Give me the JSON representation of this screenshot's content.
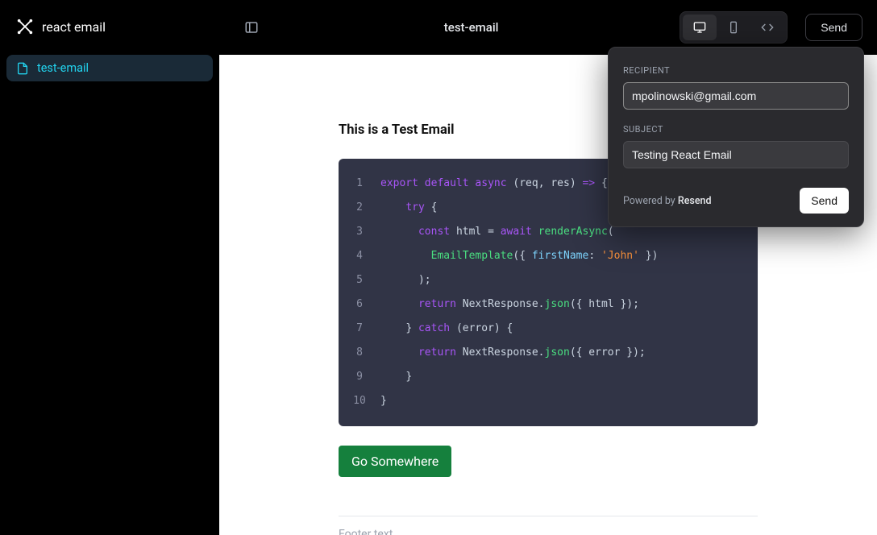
{
  "brand": {
    "name": "react email"
  },
  "sidebar": {
    "items": [
      {
        "label": "test-email"
      }
    ]
  },
  "header": {
    "title": "test-email",
    "send_label": "Send"
  },
  "preview": {
    "heading": "This is a Test Email",
    "cta_label": "Go Somewhere",
    "footer": "Footer text...",
    "code": {
      "lines": [
        {
          "n": "1",
          "indent": "",
          "tokens": [
            {
              "t": "export ",
              "c": "kw"
            },
            {
              "t": "default ",
              "c": "kw"
            },
            {
              "t": "async ",
              "c": "kw"
            },
            {
              "t": "(req, res) ",
              "c": "id"
            },
            {
              "t": "=>",
              "c": "kw"
            },
            {
              "t": " {",
              "c": "punc"
            }
          ]
        },
        {
          "n": "2",
          "indent": "    ",
          "tokens": [
            {
              "t": "try ",
              "c": "kw"
            },
            {
              "t": "{",
              "c": "punc"
            }
          ]
        },
        {
          "n": "3",
          "indent": "      ",
          "tokens": [
            {
              "t": "const ",
              "c": "kw"
            },
            {
              "t": "html ",
              "c": "id"
            },
            {
              "t": "= ",
              "c": "punc"
            },
            {
              "t": "await ",
              "c": "kw"
            },
            {
              "t": "renderAsync",
              "c": "fn"
            },
            {
              "t": "(",
              "c": "punc"
            }
          ]
        },
        {
          "n": "4",
          "indent": "        ",
          "tokens": [
            {
              "t": "EmailTemplate",
              "c": "fn"
            },
            {
              "t": "({ ",
              "c": "punc"
            },
            {
              "t": "firstName",
              "c": "prop"
            },
            {
              "t": ": ",
              "c": "punc"
            },
            {
              "t": "'John'",
              "c": "str"
            },
            {
              "t": " })",
              "c": "punc"
            }
          ]
        },
        {
          "n": "5",
          "indent": "      ",
          "tokens": [
            {
              "t": ");",
              "c": "punc"
            }
          ]
        },
        {
          "n": "6",
          "indent": "      ",
          "tokens": [
            {
              "t": "return ",
              "c": "kw"
            },
            {
              "t": "NextResponse.",
              "c": "id"
            },
            {
              "t": "json",
              "c": "fn"
            },
            {
              "t": "({ html });",
              "c": "punc"
            }
          ]
        },
        {
          "n": "7",
          "indent": "    ",
          "tokens": [
            {
              "t": "} ",
              "c": "punc"
            },
            {
              "t": "catch ",
              "c": "kw"
            },
            {
              "t": "(error) {",
              "c": "punc"
            }
          ]
        },
        {
          "n": "8",
          "indent": "      ",
          "tokens": [
            {
              "t": "return ",
              "c": "kw"
            },
            {
              "t": "NextResponse.",
              "c": "id"
            },
            {
              "t": "json",
              "c": "fn"
            },
            {
              "t": "({ error });",
              "c": "punc"
            }
          ]
        },
        {
          "n": "9",
          "indent": "    ",
          "tokens": [
            {
              "t": "}",
              "c": "punc"
            }
          ]
        },
        {
          "n": "10",
          "indent": "",
          "tokens": [
            {
              "t": "}",
              "c": "punc"
            }
          ]
        }
      ]
    }
  },
  "send_panel": {
    "recipient_label": "RECIPIENT",
    "recipient_value": "mpolinowski@gmail.com",
    "subject_label": "SUBJECT",
    "subject_value": "Testing React Email",
    "powered_prefix": "Powered by ",
    "powered_brand": "Resend",
    "send_label": "Send"
  }
}
